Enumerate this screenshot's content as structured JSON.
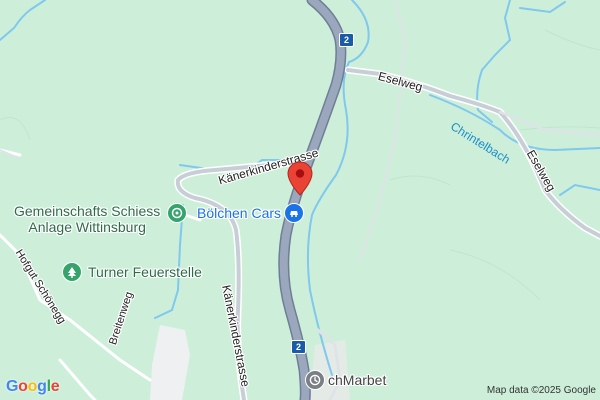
{
  "map": {
    "roads": {
      "kaenerkinderstrasse_upper": "Känerkinderstrasse",
      "kaenerkinderstrasse_lower": "Känerkinderstrasse",
      "eselweg_upper": "Eselweg",
      "eselweg_right": "Eselweg",
      "hofgut_schoenegg": "Hofgut Schönegg",
      "breitenweg": "Breitenweg"
    },
    "water": {
      "chrintelbach": "Chrintelbach"
    },
    "route_shields": [
      "2",
      "2"
    ],
    "pois": {
      "gemeinschafts": {
        "line1": "Gemeinschafts Schiess",
        "line2": "Anlage Wittinsburg",
        "icon": "target-icon"
      },
      "turner": {
        "label": "Turner Feuerstelle",
        "icon": "tree-icon"
      },
      "boelchen": {
        "label": "Bölchen Cars",
        "icon": "car-dealer-icon"
      },
      "marbet": {
        "label": "chMarbet",
        "icon": "clock-icon"
      }
    },
    "marker": {
      "icon": "location-pin-icon",
      "color": "#ea4335"
    },
    "colors": {
      "land": "#cdefd9",
      "water": "#7fc8ee",
      "motorway": "#8d9db6",
      "road": "#c7ccd4",
      "poi_green": "#34a46c",
      "poi_blue": "#1a73e8",
      "settlement": "#eef0f2"
    }
  },
  "branding": {
    "logo_letters": [
      "G",
      "o",
      "o",
      "g",
      "l",
      "e"
    ],
    "logo_colors": [
      "#4285f4",
      "#ea4335",
      "#fbbc05",
      "#4285f4",
      "#34a853",
      "#ea4335"
    ],
    "attribution": "Map data ©2025 Google"
  }
}
